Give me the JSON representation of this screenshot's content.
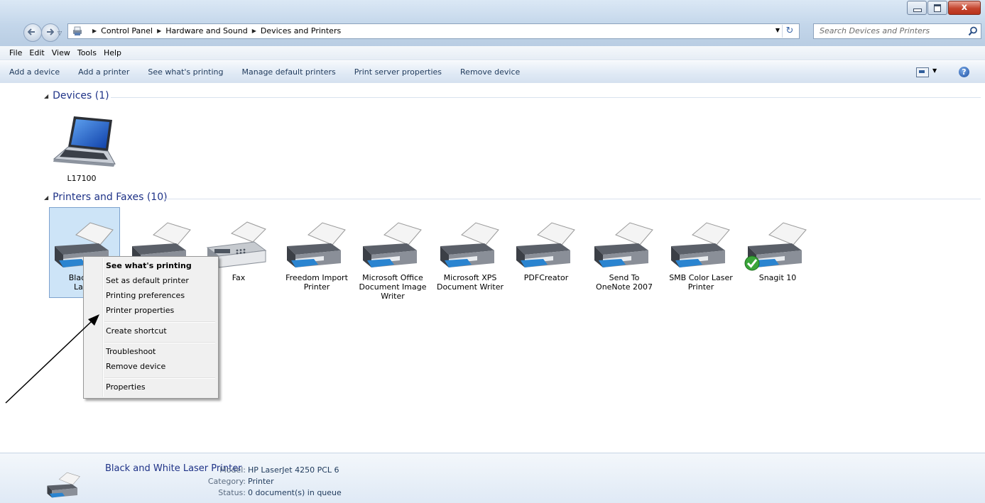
{
  "window": {
    "minimize_icon": "minimize-icon",
    "maximize_icon": "maximize-icon",
    "close_label": "x"
  },
  "address": {
    "crumbs": [
      "Control Panel",
      "Hardware and Sound",
      "Devices and Printers"
    ],
    "refresh_glyph": "↻",
    "search_placeholder": "Search Devices and Printers"
  },
  "menu": [
    "File",
    "Edit",
    "View",
    "Tools",
    "Help"
  ],
  "toolbar": {
    "commands": [
      "Add a device",
      "Add a printer",
      "See what's printing",
      "Manage default printers",
      "Print server properties",
      "Remove device"
    ],
    "help_glyph": "?"
  },
  "groups": {
    "devices": {
      "title": "Devices (1)",
      "items": [
        "L17100"
      ]
    },
    "printers": {
      "title": "Printers and Faxes (10)",
      "items": [
        "Black and White Laser Printer",
        "",
        "Fax",
        "Freedom Import Printer",
        "Microsoft Office Document Image Writer",
        "Microsoft XPS Document Writer",
        "PDFCreator",
        "Send To OneNote 2007",
        "SMB Color Laser Printer",
        "Snagit 10"
      ],
      "visible_labels": {
        "sel_line1": "Black ar",
        "sel_line2": "Laser",
        "fax": "Fax",
        "freedom1": "Freedom Import",
        "freedom2": "Printer",
        "msodi1": "Microsoft Office",
        "msodi2": "Document Image",
        "msodi3": "Writer",
        "xps1": "Microsoft XPS",
        "xps2": "Document Writer",
        "pdf": "PDFCreator",
        "onenote1": "Send To",
        "onenote2": "OneNote 2007",
        "smb1": "SMB Color Laser",
        "smb2": "Printer",
        "snagit": "Snagit 10"
      }
    }
  },
  "context_menu": {
    "items": [
      "See what's printing",
      "Set as default printer",
      "Printing preferences",
      "Printer properties",
      "Create shortcut",
      "Troubleshoot",
      "Remove device",
      "Properties"
    ],
    "default_item": "See what's printing"
  },
  "details": {
    "name": "Black and  White Laser Printer",
    "model_label": "Model:",
    "model": "HP LaserJet 4250 PCL 6",
    "category_label": "Category:",
    "category": "Printer",
    "status_label": "Status:",
    "status": "0 document(s) in queue"
  },
  "colors": {
    "group_header": "#1e3287",
    "selection": "#cde4f7",
    "toolbar_text": "#1e395b"
  }
}
